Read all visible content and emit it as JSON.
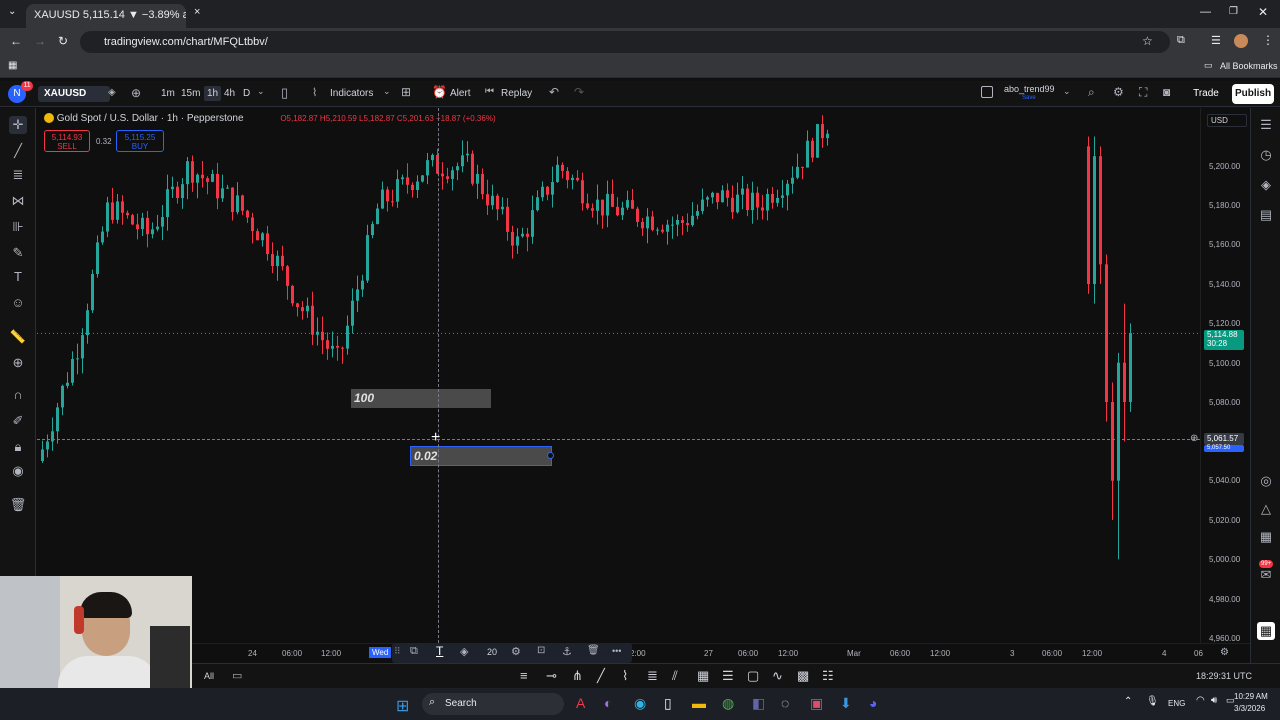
{
  "browser": {
    "tab_title": "XAUUSD 5,115.14 ▼ −3.89% al",
    "url": "tradingview.com/chart/MFQLtbbv/",
    "bookmarks_label": "All Bookmarks"
  },
  "toolbar": {
    "symbol": "XAUUSD",
    "intervals": [
      "1m",
      "15m",
      "1h",
      "4h",
      "D"
    ],
    "indicators_label": "Indicators",
    "alert_label": "Alert",
    "replay_label": "Replay",
    "account_name": "abo_trend99",
    "account_sub": "Save",
    "trade_label": "Trade",
    "publish_label": "Publish",
    "notif_count": "11"
  },
  "legend": {
    "title": "Gold Spot / U.S. Dollar · 1h · Pepperstone",
    "ohlc": "O5,182.87  H5,210.59  L5,182.87  C5,201.63  +18.87 (+0.36%)",
    "sell_price": "5,114.93",
    "sell_label": "SELL",
    "spread": "0.32",
    "buy_price": "5,115.25",
    "buy_label": "BUY"
  },
  "price_axis": {
    "currency": "USD",
    "labels": [
      "5,200.00",
      "5,180.00",
      "5,160.00",
      "5,140.00",
      "5,120.00",
      "5,100.00",
      "5,080.00",
      "5,040.00",
      "5,020.00",
      "5,000.00",
      "4,980.00",
      "4,960.00"
    ],
    "current_price": "5,114.88",
    "current_countdown": "30:28",
    "crosshair_price": "5,061.57",
    "crosshair_sub": "5,057.50"
  },
  "time_axis": {
    "labels": [
      "24",
      "06:00",
      "12:00",
      "Wed",
      "2:00",
      "27",
      "06:00",
      "12:00",
      "Mar",
      "06:00",
      "12:00",
      "3",
      "06:00",
      "12:00",
      "4",
      "06"
    ],
    "clock": "18:29:31 UTC"
  },
  "drawings": {
    "text_box_1": "100",
    "text_box_2": "0.02",
    "float_toolbar_size": "20"
  },
  "bottom": {
    "all_label": "All"
  },
  "taskbar": {
    "search_placeholder": "Search",
    "lang": "ENG",
    "time": "10:29 AM",
    "date": "3/3/2026",
    "badge": "99+"
  },
  "colors": {
    "up": "#26a69a",
    "down": "#f23645",
    "accent": "#2962ff"
  }
}
